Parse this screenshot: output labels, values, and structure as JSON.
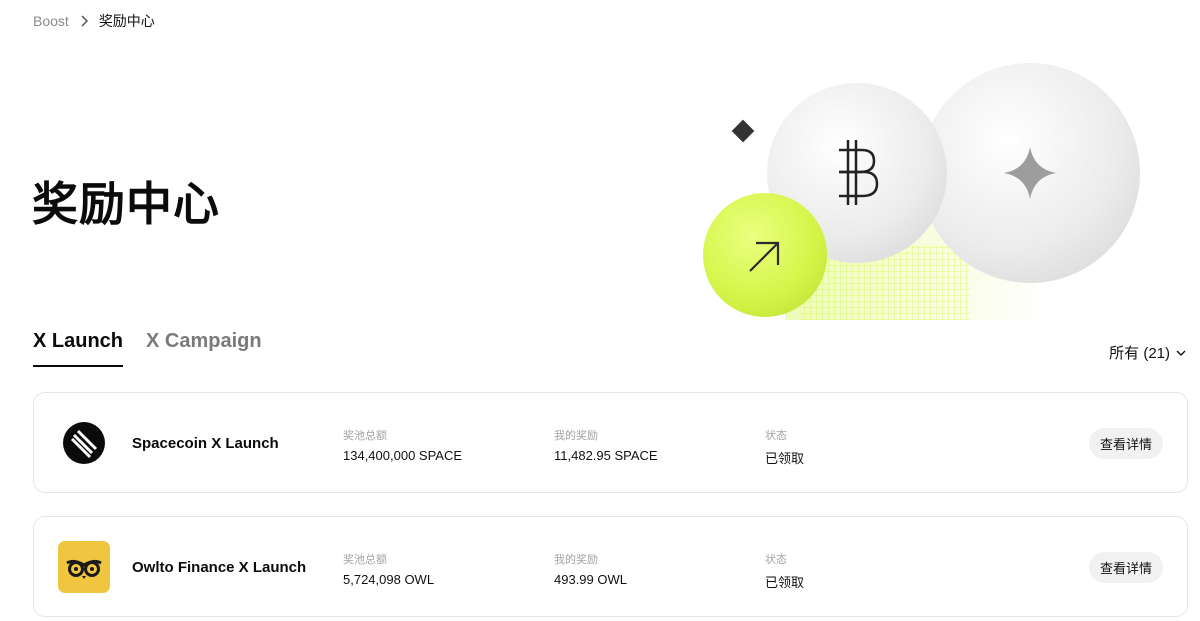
{
  "breadcrumb": {
    "root": "Boost",
    "current": "奖励中心"
  },
  "page": {
    "title": "奖励中心"
  },
  "tabs": [
    {
      "label": "X Launch",
      "active": true
    },
    {
      "label": "X Campaign",
      "active": false
    }
  ],
  "filter": {
    "label": "所有 (21)"
  },
  "columns": {
    "pool": "奖池总额",
    "mine": "我的奖励",
    "status": "状态",
    "action": "查看详情"
  },
  "rows": [
    {
      "name": "Spacecoin X Launch",
      "logo_icon": "spacecoin-logo-icon",
      "pool": "134,400,000 SPACE",
      "mine": "11,482.95 SPACE",
      "status": "已领取"
    },
    {
      "name": "Owlto Finance X Launch",
      "logo_icon": "owlto-logo-icon",
      "pool": "5,724,098 OWL",
      "mine": "493.99 OWL",
      "status": "已领取"
    }
  ],
  "colors": {
    "accent_lime": "#d6f54a",
    "owl_yellow": "#f0c640"
  }
}
